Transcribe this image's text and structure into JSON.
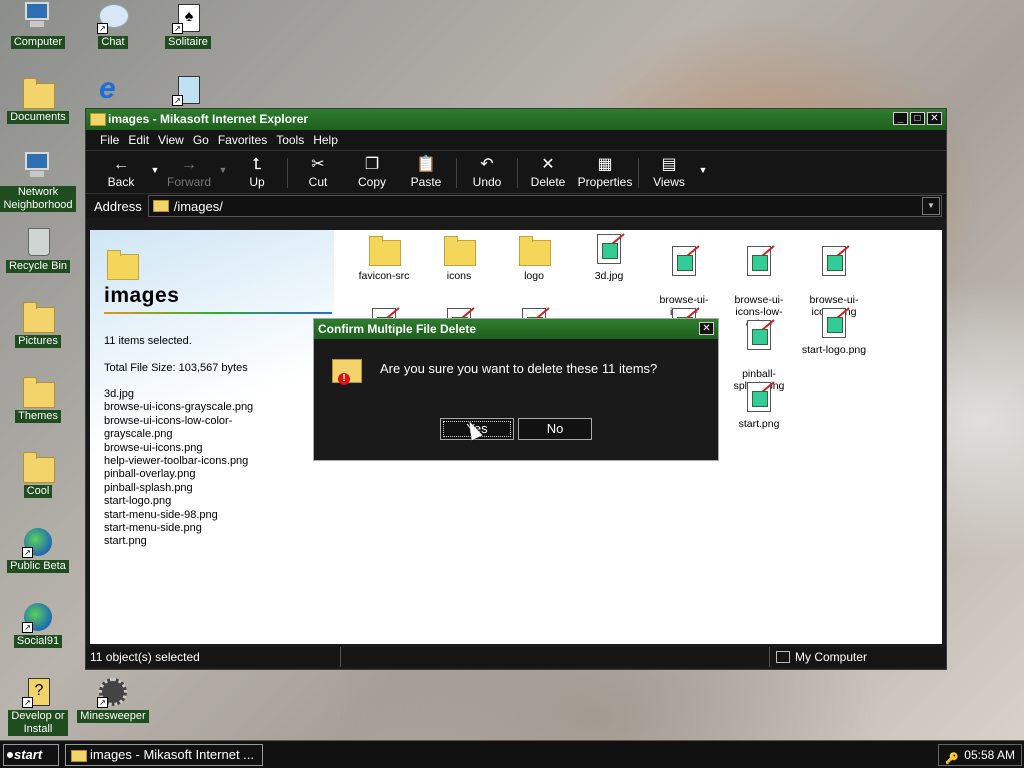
{
  "desktop": {
    "icons": [
      {
        "label": "Computer",
        "icon": "computer-icon"
      },
      {
        "label": "Chat",
        "icon": "chat-icon"
      },
      {
        "label": "Solitaire",
        "icon": "solitaire-icon"
      },
      {
        "label": "Documents",
        "icon": "documents-icon"
      },
      {
        "label": "Network\nNeighborhood",
        "icon": "network-icon"
      },
      {
        "label": "Recycle Bin",
        "icon": "recycle-bin-icon"
      },
      {
        "label": "Pictures",
        "icon": "folder-icon"
      },
      {
        "label": "Themes",
        "icon": "folder-icon"
      },
      {
        "label": "Cool",
        "icon": "folder-icon"
      },
      {
        "label": "Public Beta",
        "icon": "public-beta-icon"
      },
      {
        "label": "Social91",
        "icon": "globe-icon"
      },
      {
        "label": "Develop or\nInstall",
        "icon": "develop-icon"
      },
      {
        "label": "Minesweeper",
        "icon": "minesweeper-icon"
      }
    ]
  },
  "window": {
    "title": "images - Mikasoft Internet Explorer",
    "menu": [
      "File",
      "Edit",
      "View",
      "Go",
      "Favorites",
      "Tools",
      "Help"
    ],
    "toolbar": {
      "back": "Back",
      "forward": "Forward",
      "up": "Up",
      "cut": "Cut",
      "copy": "Copy",
      "paste": "Paste",
      "undo": "Undo",
      "delete": "Delete",
      "properties": "Properties",
      "views": "Views"
    },
    "address_label": "Address",
    "address_value": "/images/",
    "side": {
      "title": "images",
      "selected": "11 items selected.",
      "size": "Total File Size: 103,567 bytes",
      "files": [
        "3d.jpg",
        "browse-ui-icons-grayscale.png",
        "browse-ui-icons-low-color-",
        "grayscale.png",
        "browse-ui-icons.png",
        "help-viewer-toolbar-icons.png",
        "pinball-overlay.png",
        "pinball-splash.png",
        "start-logo.png",
        "start-menu-side-98.png",
        "start-menu-side.png",
        "start.png"
      ]
    },
    "files": {
      "f1": "favicon-src",
      "f2": "icons",
      "f3": "logo",
      "f4": "3d.jpg",
      "f5": "browse-ui-\nicons-",
      "f6": "browse-ui-\nicons-low-color-",
      "f7": "browse-ui-\nicons.png",
      "f8": "pinball-\nsplash.png",
      "f9": "start-logo.png",
      "f10": "start.png"
    },
    "status_left": "11 object(s) selected",
    "status_right": "My Computer"
  },
  "dialog": {
    "title": "Confirm Multiple File Delete",
    "message": "Are you sure you want to delete these 11 items?",
    "yes": "Yes",
    "no": "No"
  },
  "taskbar": {
    "start": "start",
    "task": "images - Mikasoft Internet ...",
    "clock": "05:58 AM"
  }
}
